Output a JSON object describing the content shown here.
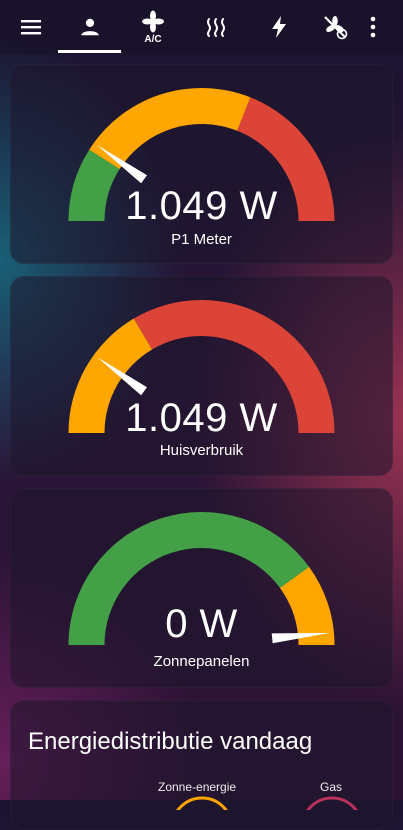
{
  "toolbar": {
    "menu_icon": "menu-icon",
    "tabs": [
      {
        "icon": "person-icon",
        "active": true
      },
      {
        "icon": "ac-fan-icon",
        "label": "A/C"
      },
      {
        "icon": "heating-icon"
      },
      {
        "icon": "lightning-icon"
      },
      {
        "icon": "fan-off-icon"
      }
    ],
    "more_icon": "more-vert-icon"
  },
  "colors": {
    "green": "#43a047",
    "orange": "#ffa600",
    "red": "#db4437",
    "needle": "#ffffff"
  },
  "gauges": [
    {
      "value_text": "1.049 W",
      "name": "P1 Meter",
      "needle_fraction": 0.2,
      "segments": [
        {
          "color": "green",
          "from": 0.0,
          "to": 0.18
        },
        {
          "color": "orange",
          "from": 0.18,
          "to": 0.62
        },
        {
          "color": "red",
          "from": 0.62,
          "to": 1.0
        }
      ]
    },
    {
      "value_text": "1.049 W",
      "name": "Huisverbruik",
      "needle_fraction": 0.2,
      "segments": [
        {
          "color": "orange",
          "from": 0.0,
          "to": 0.33
        },
        {
          "color": "red",
          "from": 0.33,
          "to": 1.0
        }
      ]
    },
    {
      "value_text": "0 W",
      "name": "Zonnepanelen",
      "needle_fraction": 0.97,
      "segments": [
        {
          "color": "green",
          "from": 0.0,
          "to": 0.8
        },
        {
          "color": "orange",
          "from": 0.8,
          "to": 1.0
        }
      ]
    }
  ],
  "distribution": {
    "title": "Energiedistributie vandaag",
    "labels": [
      "Zonne-energie",
      "Gas"
    ]
  }
}
